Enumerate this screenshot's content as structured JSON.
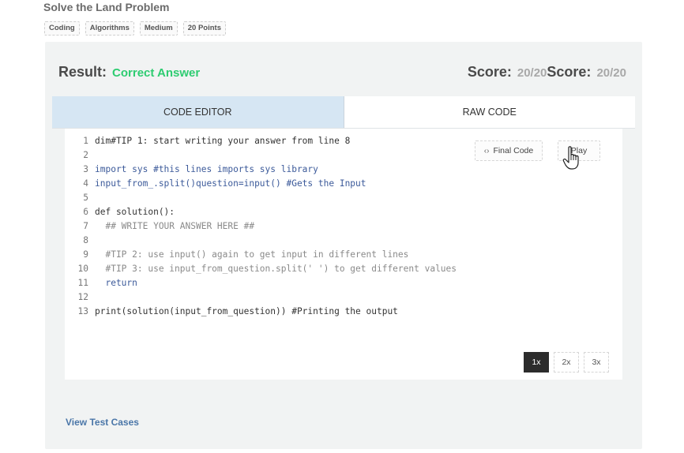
{
  "problem": {
    "title": "Solve the Land Problem",
    "tags": [
      "Coding",
      "Algorithms",
      "Medium",
      "20 Points"
    ]
  },
  "result": {
    "label": "Result:",
    "status": "Correct Answer",
    "status_color": "#2ecc71",
    "score_label": "Score:",
    "score_value": "20/20",
    "score_label_2": "Score:",
    "score_value_2": "20/20"
  },
  "tabs": [
    {
      "label": "CODE EDITOR",
      "active": true
    },
    {
      "label": "RAW CODE",
      "active": false
    }
  ],
  "editor": {
    "final_code_label": "Final Code",
    "final_code_icon": "code-brackets-icon",
    "play_label": "Play",
    "lines": [
      {
        "n": "1",
        "text": "dim#TIP 1: start writing your answer from line 8"
      },
      {
        "n": "2",
        "text": ""
      },
      {
        "n": "3",
        "text": "import sys #this lines imports sys library"
      },
      {
        "n": "4",
        "text": "input_from_.split()question=input() #Gets the Input"
      },
      {
        "n": "5",
        "text": ""
      },
      {
        "n": "6",
        "text": "def solution():"
      },
      {
        "n": "7",
        "text": "  ## WRITE YOUR ANSWER HERE ##"
      },
      {
        "n": "8",
        "text": ""
      },
      {
        "n": "9",
        "text": "  #TIP 2: use input() again to get input in different lines"
      },
      {
        "n": "10",
        "text": "  #TIP 3: use input_from_question.split(' ') to get different values"
      },
      {
        "n": "11",
        "text": "  return"
      },
      {
        "n": "12",
        "text": ""
      },
      {
        "n": "13",
        "text": "print(solution(input_from_question)) #Printing the output"
      }
    ],
    "speeds": [
      "1x",
      "2x",
      "3x"
    ],
    "active_speed": "1x"
  },
  "footer": {
    "view_test_cases": "View Test Cases"
  },
  "colors": {
    "accent_blue": "#4a76a8",
    "tab_active_bg": "#d6e6f3"
  }
}
